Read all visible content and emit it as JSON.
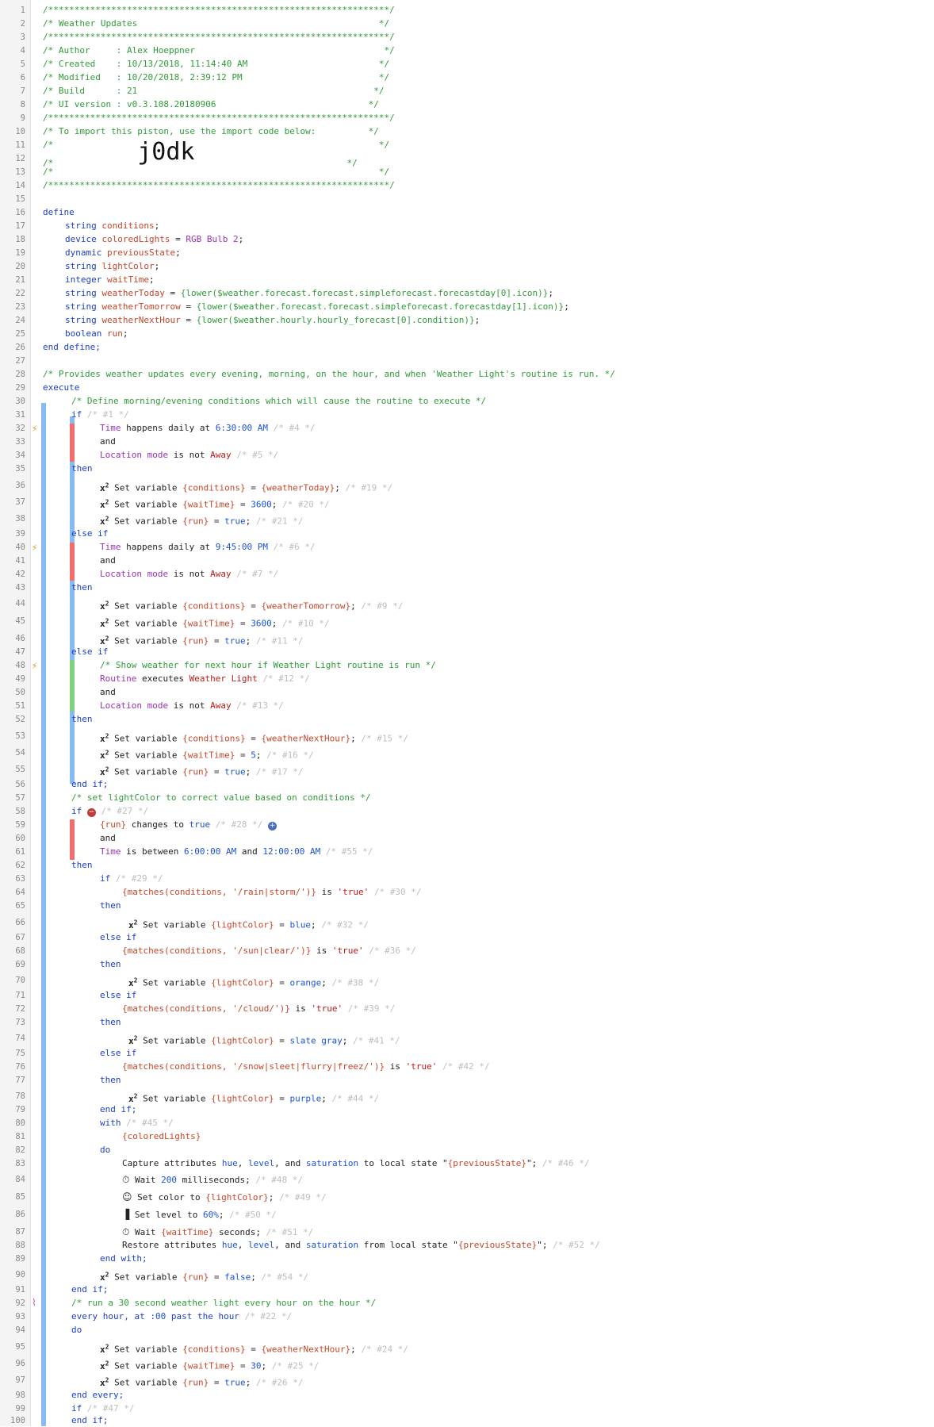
{
  "header": {
    "border": "/*****************************************************************/",
    "title": "/* Weather Updates                                              */",
    "author": "/* Author     : Alex Hoeppner                                    */",
    "created": "/* Created    : 10/13/2018, 11:14:40 AM                         */",
    "modified": "/* Modified   : 10/20/2018, 2:39:12 PM                          */",
    "build": "/* Build      : 21                                             */",
    "ui_version": "/* UI version : v0.3.108.20180906                             */",
    "import_note": "/* To import this piston, use the import code below:          */",
    "blank": "/*                                                              */",
    "code_left": "/*                ",
    "import_code": "j0dk",
    "code_right": "                             */"
  },
  "line_numbers": [
    "1",
    "2",
    "3",
    "4",
    "5",
    "6",
    "7",
    "8",
    "9",
    "10",
    "11",
    "12",
    "13",
    "14",
    "15",
    "16",
    "17",
    "18",
    "19",
    "20",
    "21",
    "22",
    "23",
    "24",
    "25",
    "26",
    "27",
    "28",
    "29",
    "30",
    "31",
    "32",
    "33",
    "34",
    "35",
    "36",
    "37",
    "38",
    "39",
    "40",
    "41",
    "42",
    "43",
    "44",
    "45",
    "46",
    "47",
    "48",
    "49",
    "50",
    "51",
    "52",
    "53",
    "54",
    "55",
    "56",
    "57",
    "58",
    "59",
    "60",
    "61",
    "62",
    "63",
    "64",
    "65",
    "66",
    "67",
    "68",
    "69",
    "70",
    "71",
    "72",
    "73",
    "74",
    "75",
    "76",
    "77",
    "78",
    "79",
    "80",
    "81",
    "82",
    "83",
    "84",
    "85",
    "86",
    "87",
    "88",
    "89",
    "90",
    "91",
    "92",
    "93",
    "94",
    "95",
    "96",
    "97",
    "98",
    "99",
    "100"
  ],
  "code": {
    "define": "define",
    "end_define": "end define;",
    "execute": "execute",
    "and": "and",
    "then": "then",
    "else_if": "else if",
    "if": "if",
    "end_if": "end if;",
    "do": "do",
    "with": "with",
    "end_with": "end with;",
    "end_every": "end every;",
    "set_variable": "Set variable ",
    "string": "string",
    "device": "device",
    "dynamic": "dynamic",
    "integer": "integer",
    "boolean": "boolean",
    "conditions": "conditions",
    "coloredLights": "coloredLights",
    "rgb_bulb": "RGB Bulb 2",
    "previousState": "previousState",
    "lightColor": "lightColor",
    "waitTime": "waitTime",
    "weatherToday": "weatherToday",
    "weatherTomorrow": "weatherTomorrow",
    "weatherNextHour": "weatherNextHour",
    "run": "run",
    "expr_today": "{lower($weather.forecast.forecast.simpleforecast.forecastday[0].icon)}",
    "expr_tomorrow": "{lower($weather.forecast.forecast.simpleforecast.forecastday[1].icon)}",
    "expr_nexthour": "{lower($weather.hourly.hourly_forecast[0].condition)}",
    "cmt_provides": "/* Provides weather updates every evening, morning, on the hour, and when 'Weather Light's routine is run. */",
    "cmt_define_morning": "/* Define morning/evening conditions which will cause the routine to execute */",
    "cmt_show_weather": "/* Show weather for next hour if Weather Light routine is run */",
    "cmt_set_lightcolor": "/* set lightColor to correct value based on conditions */",
    "cmt_run_30": "/* run a 30 second weather light every hour on the hour */",
    "time": "Time",
    "happens_daily_at": " happens daily at ",
    "t_630": "6:30:00 AM",
    "t_945": "9:45:00 PM",
    "location_mode": "Location mode",
    "is_not": " is not ",
    "away": "Away",
    "routine": "Routine",
    "executes": " executes ",
    "weather_light": "Weather Light",
    "v_conditions": "{conditions}",
    "v_waitTime": "{waitTime}",
    "v_run": "{run}",
    "v_lightColor": "{lightColor}",
    "v_weatherToday": "{weatherToday}",
    "v_weatherTomorrow": "{weatherTomorrow}",
    "v_weatherNextHour": "{weatherNextHour}",
    "v_coloredLights": "{coloredLights}",
    "v_previousState": "{previousState}",
    "n_3600": "3600",
    "n_5": "5",
    "n_30": "30",
    "true": "true",
    "false": "false",
    "changes_to": " changes to ",
    "is_between": " is between ",
    "t_600": "6:00:00 AM",
    "t_1200": "12:00:00 AM",
    "m_rain": "{matches(conditions, '/rain|storm/')}",
    "m_sun": "{matches(conditions, '/sun|clear/')}",
    "m_cloud": "{matches(conditions, '/cloud/')}",
    "m_snow": "{matches(conditions, '/snow|sleet|flurry|freez/')}",
    "is": " is ",
    "q_true": "'true'",
    "blue": "blue",
    "orange": "orange",
    "slate_gray": "slate gray",
    "purple": "purple",
    "capture": "Capture attributes ",
    "hue": "hue",
    "level": "level",
    "saturation": "saturation",
    "to_local_state": " to local state \"",
    "restore": "Restore attributes ",
    "from_local_state": " from local state \"",
    "wait": "Wait ",
    "n_200": "200",
    "milliseconds": " milliseconds;",
    "seconds": " seconds;",
    "set_color_to": "Set color to ",
    "set_level_to": "Set level to ",
    "pct_60": "60%",
    "every_hour": "every hour, at ",
    "t_00": ":00",
    "past_the_hour": " past the hour "
  },
  "ids": {
    "c1": "/* #1 */",
    "c4": "/* #4 */",
    "c5": "/* #5 */",
    "c19": "/* #19 */",
    "c20": "/* #20 */",
    "c21": "/* #21 */",
    "c6": "/* #6 */",
    "c7": "/* #7 */",
    "c9": "/* #9 */",
    "c10": "/* #10 */",
    "c11": "/* #11 */",
    "c12": "/* #12 */",
    "c13": "/* #13 */",
    "c15": "/* #15 */",
    "c16": "/* #16 */",
    "c17": "/* #17 */",
    "c27": "/* #27 */",
    "c28": "/* #28 */",
    "c55": "/* #55 */",
    "c29": "/* #29 */",
    "c30": "/* #30 */",
    "c32": "/* #32 */",
    "c36": "/* #36 */",
    "c38": "/* #38 */",
    "c39": "/* #39 */",
    "c41": "/* #41 */",
    "c42": "/* #42 */",
    "c44": "/* #44 */",
    "c45": "/* #45 */",
    "c46": "/* #46 */",
    "c48": "/* #48 */",
    "c49": "/* #49 */",
    "c50": "/* #50 */",
    "c51": "/* #51 */",
    "c52": "/* #52 */",
    "c54": "/* #54 */",
    "c22": "/* #22 */",
    "c24": "/* #24 */",
    "c25": "/* #25 */",
    "c26": "/* #26 */",
    "c47": "/* #47 */"
  },
  "icons": [
    "bolt-icon",
    "timer-icon",
    "clock-icon",
    "palette-icon",
    "level-bars-icon",
    "plus-circle-icon",
    "no-entry-icon",
    "variable-icon"
  ]
}
